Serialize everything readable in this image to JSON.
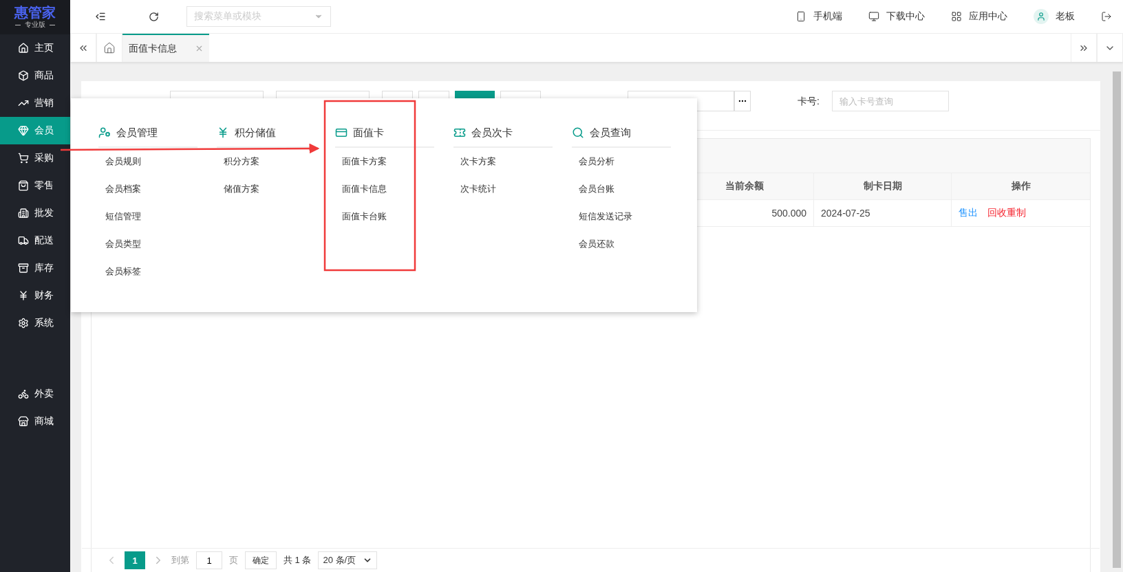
{
  "brand": {
    "name": "惠管家",
    "edition": "专业版"
  },
  "sidebar": {
    "items": [
      {
        "label": "主页",
        "selected": false
      },
      {
        "label": "商品",
        "selected": false
      },
      {
        "label": "营销",
        "selected": false
      },
      {
        "label": "会员",
        "selected": true
      },
      {
        "label": "采购",
        "selected": false
      },
      {
        "label": "零售",
        "selected": false
      },
      {
        "label": "批发",
        "selected": false
      },
      {
        "label": "配送",
        "selected": false
      },
      {
        "label": "库存",
        "selected": false
      },
      {
        "label": "财务",
        "selected": false
      },
      {
        "label": "系统",
        "selected": false
      }
    ],
    "extra_items": [
      {
        "label": "外卖",
        "selected": false
      },
      {
        "label": "商城",
        "selected": false
      }
    ]
  },
  "top_bar": {
    "search": {
      "placeholder": "搜索菜单或模块"
    },
    "links": [
      {
        "label": "手机端"
      },
      {
        "label": "下载中心"
      },
      {
        "label": "应用中心"
      }
    ],
    "user": "老板"
  },
  "tabs": [
    {
      "label": "面值卡信息",
      "selected": true
    }
  ],
  "filters": {
    "card_no": {
      "label": "卡号:",
      "placeholder": "输入卡号查询"
    }
  },
  "table": {
    "columns": [
      "当前余额",
      "制卡日期",
      "操作"
    ],
    "rows": [
      {
        "balance": "500.000",
        "date": "2024-07-25",
        "actions": [
          {
            "label": "售出",
            "kind": "primary"
          },
          {
            "label": "回收重制",
            "kind": "danger"
          }
        ]
      }
    ]
  },
  "pagination": {
    "pages": [
      {
        "label": "1",
        "selected": true
      }
    ],
    "goto_label": "到第",
    "goto_value": "1",
    "page_unit": "页",
    "confirm": "确定",
    "total": "共 1 条",
    "page_size": "20 条/页"
  },
  "mega_menu": {
    "columns": [
      {
        "title": "会员管理",
        "items": [
          "会员规则",
          "会员档案",
          "短信管理",
          "会员类型",
          "会员标签"
        ]
      },
      {
        "title": "积分储值",
        "items": [
          "积分方案",
          "储值方案"
        ]
      },
      {
        "title": "面值卡",
        "items": [
          "面值卡方案",
          "面值卡信息",
          "面值卡台账"
        ]
      },
      {
        "title": "会员次卡",
        "items": [
          "次卡方案",
          "次卡统计"
        ]
      },
      {
        "title": "会员查询",
        "items": [
          "会员分析",
          "会员台账",
          "短信发送记录",
          "会员还款"
        ]
      }
    ]
  }
}
